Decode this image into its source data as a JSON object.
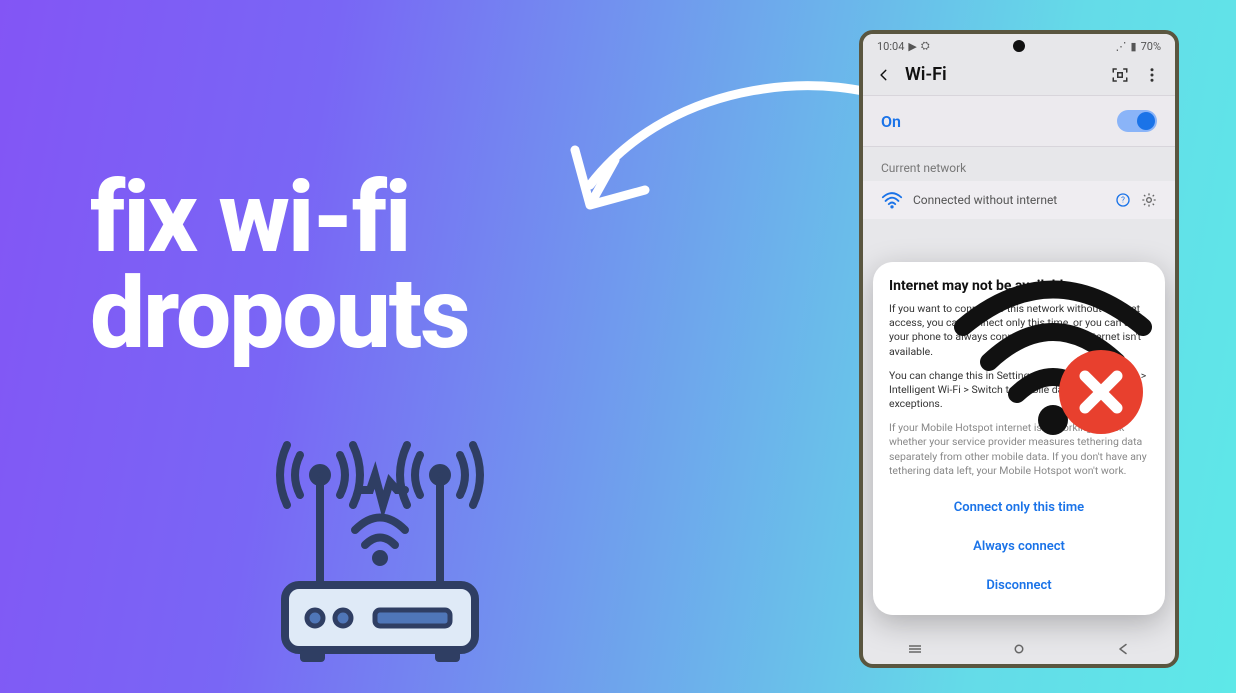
{
  "headline": {
    "line1": "fix wi-fi",
    "line2": "dropouts"
  },
  "phone": {
    "status": {
      "time": "10:04",
      "battery": "70%"
    },
    "header": {
      "title": "Wi-Fi"
    },
    "toggle": {
      "label": "On"
    },
    "section_label": "Current network",
    "network": {
      "status": "Connected without internet"
    },
    "dialog": {
      "title": "Internet may not be available",
      "p1": "If you want to connect to this network without internet access, you can connect only this time, or you can set your phone to always connect to it even if internet isn't available.",
      "p2": "You can change this in Settings > Connections > Wi-Fi > Intelligent Wi-Fi > Switch to mobile data > Network exceptions.",
      "p3": "If your Mobile Hotspot internet isn't working, check whether your service provider measures tethering data separately from other mobile data. If you don't have any tethering data left, your Mobile Hotspot won't work.",
      "btn_once": "Connect only this time",
      "btn_always": "Always connect",
      "btn_disconnect": "Disconnect"
    }
  }
}
